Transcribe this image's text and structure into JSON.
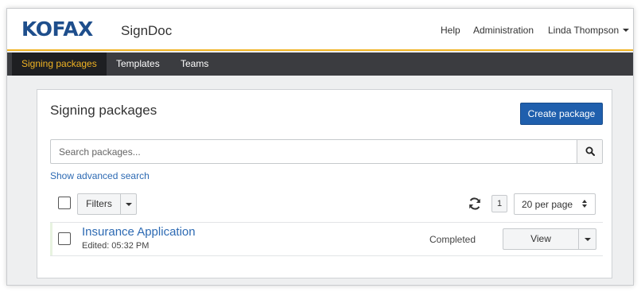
{
  "header": {
    "logo": "KOFAX",
    "product": "SignDoc",
    "links": {
      "help": "Help",
      "administration": "Administration",
      "user": "Linda Thompson"
    }
  },
  "colors": {
    "brand": "#1e4e8c",
    "accent": "#f0b323",
    "primary_button": "#1f5fad",
    "link": "#2d6ab3"
  },
  "nav": {
    "tabs": [
      {
        "label": "Signing packages",
        "active": true
      },
      {
        "label": "Templates",
        "active": false
      },
      {
        "label": "Teams",
        "active": false
      }
    ]
  },
  "main": {
    "title": "Signing packages",
    "create_button": "Create package",
    "search": {
      "placeholder": "Search packages...",
      "value": "",
      "icon": "search-icon"
    },
    "advanced_search_link": "Show advanced search",
    "toolbar": {
      "filters_label": "Filters",
      "refresh_icon": "refresh-icon",
      "current_page": "1",
      "per_page": "20 per page"
    },
    "packages": [
      {
        "name": "Insurance Application",
        "edited": "Edited: 05:32 PM",
        "status": "Completed",
        "action": "View"
      }
    ]
  }
}
